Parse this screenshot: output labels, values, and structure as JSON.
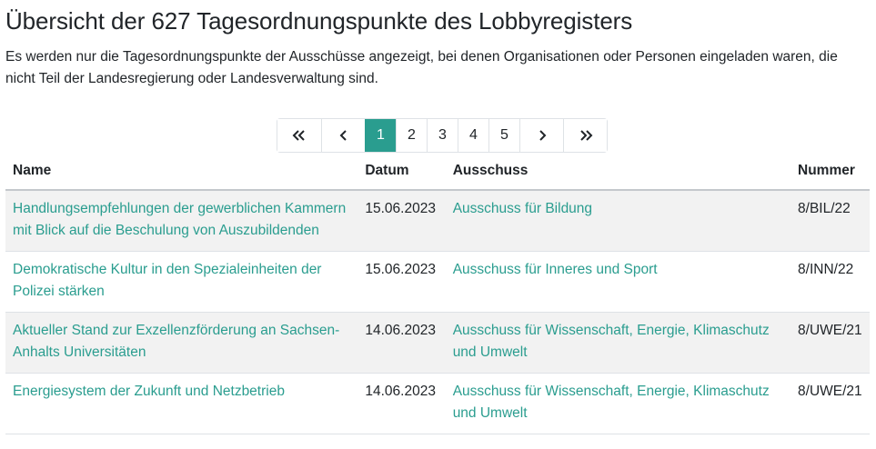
{
  "page": {
    "title": "Übersicht der 627 Tagesordnungspunkte des Lobbyregisters",
    "intro": "Es werden nur die Tagesordnungspunkte der Ausschüsse angezeigt, bei denen Organisationen oder Personen eingeladen waren, die nicht Teil der Landesregierung oder Landesverwaltung sind."
  },
  "pagination": {
    "pages": [
      "1",
      "2",
      "3",
      "4",
      "5"
    ],
    "current": "1",
    "icons": {
      "first": "double-chevron-left-icon",
      "prev": "chevron-left-icon",
      "next": "chevron-right-icon",
      "last": "double-chevron-right-icon"
    }
  },
  "table": {
    "headers": {
      "name": "Name",
      "datum": "Datum",
      "ausschuss": "Ausschuss",
      "nummer": "Nummer"
    },
    "rows": [
      {
        "name": "Handlungsempfehlungen der gewerblichen Kam­mern mit Blick auf die Beschulung von Auszubilden­den",
        "datum": "15.06.2023",
        "ausschuss": "Ausschuss für Bildung",
        "nummer": "8/BIL/22"
      },
      {
        "name": "Demokratische Kultur in den Spezialeinheiten der Polizei stärken",
        "datum": "15.06.2023",
        "ausschuss": "Ausschuss für Inneres und Sport",
        "nummer": "8/INN/22"
      },
      {
        "name": "Aktueller Stand zur Exzellenzförderung an Sachsen-Anhalts Universitäten",
        "datum": "14.06.2023",
        "ausschuss": "Ausschuss für Wissenschaft, Energie, Klimaschutz und Umwelt",
        "nummer": "8/UWE/21"
      },
      {
        "name": "Energiesystem der Zukunft und Netzbetrieb",
        "datum": "14.06.2023",
        "ausschuss": "Ausschuss für Wissenschaft, Energie, Klimaschutz und Umwelt",
        "nummer": "8/UWE/21"
      }
    ]
  },
  "colors": {
    "accent": "#2a9d8f",
    "stripe": "#f2f2f2",
    "text": "#212529"
  }
}
